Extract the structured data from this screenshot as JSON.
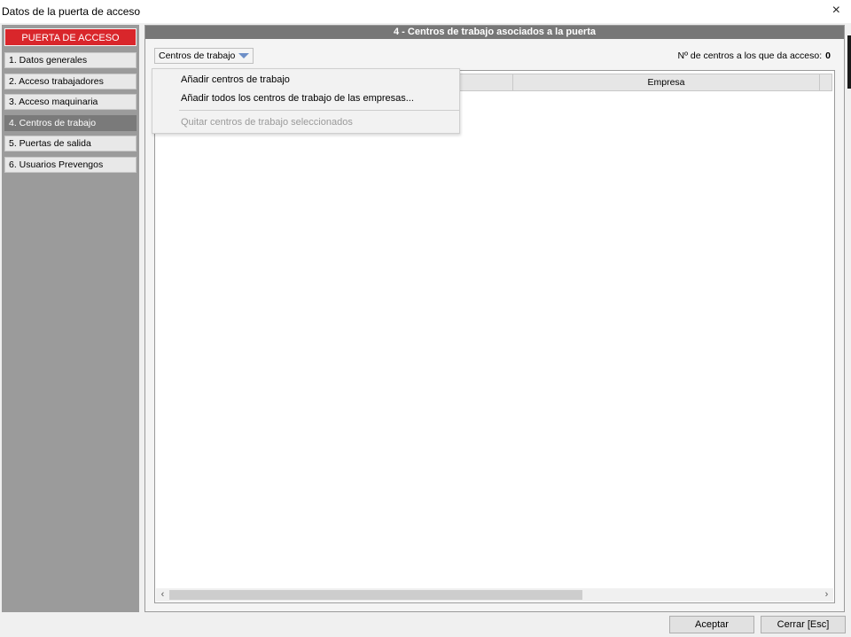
{
  "window": {
    "title": "Datos de la puerta de acceso",
    "close_glyph": "×"
  },
  "sidebar": {
    "header": "PUERTA DE ACCESO",
    "items": [
      {
        "label": "1. Datos generales",
        "active": false
      },
      {
        "label": "2. Acceso trabajadores",
        "active": false
      },
      {
        "label": "3. Acceso maquinaria",
        "active": false
      },
      {
        "label": "4. Centros de trabajo",
        "active": true
      },
      {
        "label": "5. Puertas de salida",
        "active": false
      },
      {
        "label": "6. Usuarios Prevengos",
        "active": false
      }
    ]
  },
  "main": {
    "header": "4 - Centros de trabajo asociados a la puerta",
    "dropdown_label": "Centros de trabajo",
    "count_label": "Nº de centros a los que da acceso:",
    "count_value": "0",
    "table": {
      "columns": [
        "",
        "Empresa",
        ""
      ]
    }
  },
  "menu": {
    "items": [
      {
        "label": "Añadir centros de trabajo",
        "enabled": true
      },
      {
        "label": "Añadir todos los centros de trabajo de las empresas...",
        "enabled": true
      },
      {
        "label": "Quitar centros de trabajo seleccionados",
        "enabled": false
      }
    ]
  },
  "footer": {
    "accept_label": "Aceptar",
    "close_label": "Cerrar [Esc]"
  },
  "colors": {
    "accent_red": "#d9262b",
    "active_nav": "#7a7a7a",
    "header_gray": "#777777",
    "sidebar_bg": "#9b9b9b"
  },
  "icons": {
    "dropdown": "chevron-down-icon",
    "scroll_left": "arrow-left-icon",
    "scroll_right": "arrow-right-icon",
    "close": "close-icon"
  }
}
